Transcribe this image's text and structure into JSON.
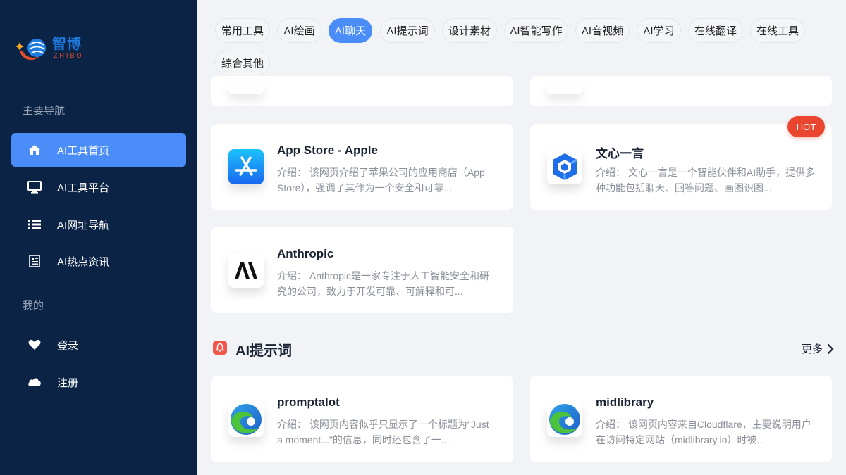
{
  "logo": {
    "cn": "智博",
    "en": "ZHIBO"
  },
  "sidebar": {
    "group_main": "主要导航",
    "group_mine": "我的",
    "items": [
      {
        "label": "AI工具首页",
        "icon": "home-icon",
        "active": true
      },
      {
        "label": "AI工具平台",
        "icon": "monitor-icon"
      },
      {
        "label": "AI网址导航",
        "icon": "list-icon"
      },
      {
        "label": "AI热点资讯",
        "icon": "news-icon"
      }
    ],
    "mine_items": [
      {
        "label": "登录",
        "icon": "heart-icon"
      },
      {
        "label": "注册",
        "icon": "cloud-icon"
      }
    ]
  },
  "tabs": [
    {
      "label": "常用工具"
    },
    {
      "label": "AI绘画"
    },
    {
      "label": "AI聊天",
      "active": true
    },
    {
      "label": "AI提示词"
    },
    {
      "label": "设计素材"
    },
    {
      "label": "AI智能写作"
    },
    {
      "label": "AI音视频"
    },
    {
      "label": "AI学习"
    },
    {
      "label": "在线翻译"
    },
    {
      "label": "在线工具"
    },
    {
      "label": "综合其他"
    }
  ],
  "chat_cards": [
    {
      "title": "App Store - Apple",
      "desc": "介绍： 该网页介绍了苹果公司的应用商店（App Store），强调了其作为一个安全和可靠...",
      "icon": "app-store-icon"
    },
    {
      "title": "文心一言",
      "desc": "介绍： 文心一言是一个智能伙伴和AI助手，提供多种功能包括聊天、回答问题、画图识图...",
      "icon": "wenxin-icon",
      "badge": "HOT"
    },
    {
      "title": "Anthropic",
      "desc": "介绍： Anthropic是一家专注于人工智能安全和研究的公司，致力于开发可靠、可解释和可...",
      "icon": "anthropic-icon"
    }
  ],
  "prompt_section": {
    "title": "AI提示词",
    "more": "更多",
    "cards": [
      {
        "title": "promptalot",
        "desc": "介绍： 该网页内容似乎只显示了一个标题为\"Just a moment...\"的信息，同时还包含了一...",
        "icon": "edge-icon"
      },
      {
        "title": "midlibrary",
        "desc": "介绍： 该网页内容来自Cloudflare，主要说明用户在访问特定网站（midlibrary.io）时被...",
        "icon": "edge-icon"
      }
    ]
  },
  "colors": {
    "sidebar": "#0b2345",
    "accent": "#4a8df8",
    "hot": "#e9452f",
    "background": "#f1f3f7"
  }
}
